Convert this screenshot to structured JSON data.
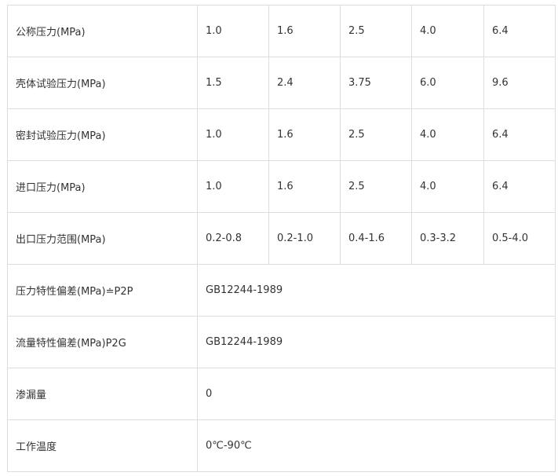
{
  "table": {
    "rows": [
      {
        "label": "公称压力(MPa)",
        "values": [
          "1.0",
          "1.6",
          "2.5",
          "4.0",
          "6.4"
        ]
      },
      {
        "label": "壳体试验压力(MPa)",
        "values": [
          "1.5",
          "2.4",
          "3.75",
          "6.0",
          "9.6"
        ]
      },
      {
        "label": "密封试验压力(MPa)",
        "values": [
          "1.0",
          "1.6",
          "2.5",
          "4.0",
          "6.4"
        ]
      },
      {
        "label": "进口压力(MPa)",
        "values": [
          "1.0",
          "1.6",
          "2.5",
          "4.0",
          "6.4"
        ]
      },
      {
        "label": "出口压力范围(MPa)",
        "values": [
          "0.2-0.8",
          "0.2-1.0",
          "0.4-1.6",
          "0.3-3.2",
          "0.5-4.0"
        ]
      },
      {
        "label": "压力特性偏差(MPa)≐P2P",
        "value": "GB12244-1989"
      },
      {
        "label": "流量特性偏差(MPa)P2G",
        "value": "GB12244-1989"
      },
      {
        "label": "渗漏量",
        "value": "0"
      },
      {
        "label": "工作温度",
        "value": "0℃-90℃"
      }
    ]
  }
}
